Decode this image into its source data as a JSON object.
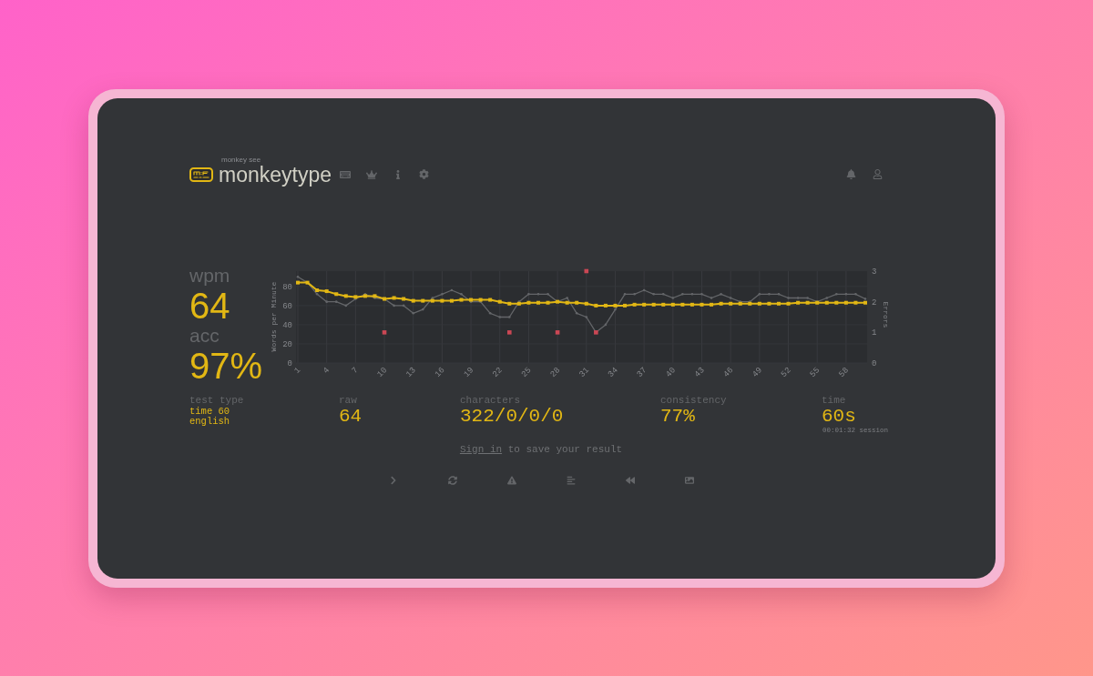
{
  "header": {
    "logo": {
      "caption": "monkey see",
      "name": "monkeytype"
    }
  },
  "result": {
    "wpm": {
      "label": "wpm",
      "value": "64"
    },
    "acc": {
      "label": "acc",
      "value": "97%"
    },
    "chart_data": [
      {
        "type": "line",
        "ylabel": "Words per Minute",
        "y2label": "Errors",
        "x": [
          1,
          2,
          3,
          4,
          5,
          6,
          7,
          8,
          9,
          10,
          11,
          12,
          13,
          14,
          15,
          16,
          17,
          18,
          19,
          20,
          21,
          22,
          23,
          24,
          25,
          26,
          27,
          28,
          29,
          30,
          31,
          32,
          33,
          34,
          35,
          36,
          37,
          38,
          39,
          40,
          41,
          42,
          43,
          44,
          45,
          46,
          47,
          48,
          49,
          50,
          51,
          52,
          53,
          54,
          55,
          56,
          57,
          58,
          59,
          60
        ],
        "xlim": [
          1,
          60
        ],
        "ylim": [
          0,
          96
        ],
        "y2lim": [
          0,
          3
        ],
        "xticks": [
          1,
          4,
          7,
          10,
          13,
          16,
          19,
          22,
          25,
          28,
          31,
          34,
          37,
          40,
          43,
          46,
          49,
          52,
          55,
          58
        ],
        "yticks": [
          0,
          20,
          40,
          60,
          80
        ],
        "y2ticks": [
          0,
          1,
          2,
          3
        ],
        "grid": true,
        "series": [
          {
            "type": "line",
            "marker": "square",
            "color": "#e2b714",
            "values": [
              84,
              84,
              76,
              75,
              72,
              70,
              69,
              70,
              70,
              67,
              68,
              67,
              65,
              65,
              65,
              65,
              65,
              66,
              66,
              66,
              66,
              64,
              62,
              62,
              63,
              63,
              63,
              64,
              63,
              63,
              62,
              60,
              60,
              60,
              60,
              61,
              61,
              61,
              61,
              61,
              61,
              61,
              61,
              61,
              62,
              62,
              62,
              62,
              62,
              62,
              62,
              62,
              63,
              63,
              63,
              63,
              63,
              63,
              63,
              63
            ]
          },
          {
            "type": "line",
            "color": "#646669",
            "values": [
              90,
              84,
              72,
              64,
              64,
              60,
              67,
              72,
              68,
              67,
              60,
              60,
              52,
              56,
              68,
              72,
              76,
              72,
              64,
              64,
              52,
              48,
              48,
              64,
              72,
              72,
              72,
              64,
              68,
              52,
              48,
              32,
              40,
              56,
              72,
              72,
              76,
              72,
              72,
              68,
              72,
              72,
              72,
              68,
              72,
              68,
              64,
              64,
              72,
              72,
              72,
              68,
              68,
              68,
              64,
              68,
              72,
              72,
              72,
              67
            ]
          },
          {
            "type": "scatter",
            "marker": "square",
            "axis": "y2",
            "color": "#ca4754",
            "x": [
              10,
              23,
              28,
              31,
              32
            ],
            "values": [
              1,
              1,
              1,
              3,
              1
            ]
          }
        ]
      }
    ]
  },
  "stats": [
    {
      "kind": "info",
      "label": "test type",
      "lines": [
        "time 60",
        "english"
      ]
    },
    {
      "kind": "big",
      "label": "raw",
      "value": "64"
    },
    {
      "kind": "big",
      "label": "characters",
      "value": "322/0/0/0"
    },
    {
      "kind": "big",
      "label": "consistency",
      "value": "77%"
    },
    {
      "kind": "big",
      "label": "time",
      "value": "60s",
      "note": "00:01:32 session"
    }
  ],
  "save_prompt": {
    "link": "Sign in",
    "text": "to save your result"
  }
}
